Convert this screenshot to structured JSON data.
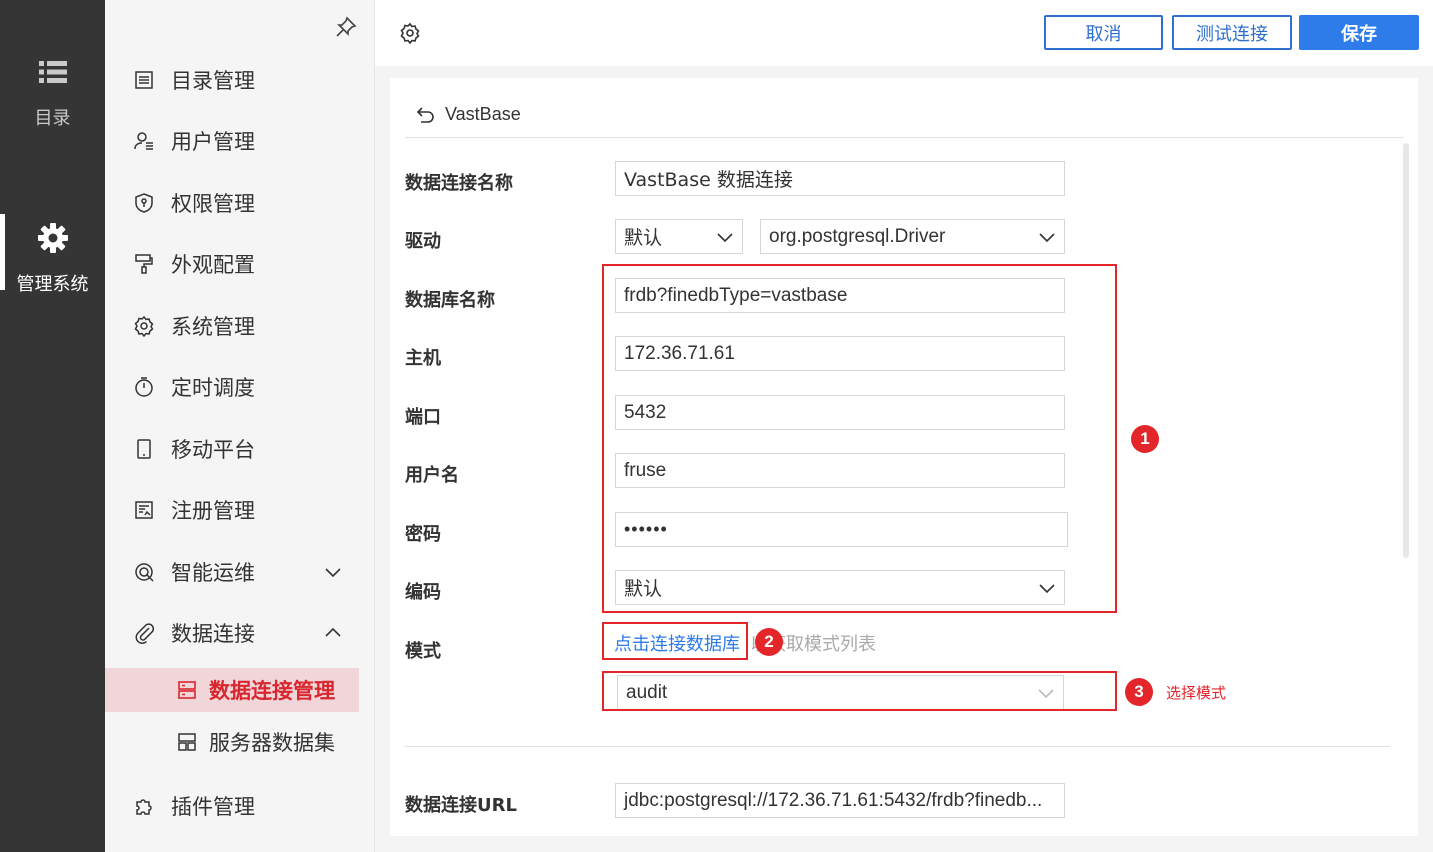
{
  "rail": {
    "catalog_label": "目录",
    "admin_label": "管理系统"
  },
  "menu": {
    "items": [
      {
        "label": "目录管理"
      },
      {
        "label": "用户管理"
      },
      {
        "label": "权限管理"
      },
      {
        "label": "外观配置"
      },
      {
        "label": "系统管理"
      },
      {
        "label": "定时调度"
      },
      {
        "label": "移动平台"
      },
      {
        "label": "注册管理"
      },
      {
        "label": "智能运维"
      },
      {
        "label": "数据连接"
      },
      {
        "label": "插件管理"
      }
    ],
    "sub_items": [
      {
        "label": "数据连接管理",
        "active": true
      },
      {
        "label": "服务器数据集",
        "active": false
      }
    ]
  },
  "toolbar": {
    "cancel_label": "取消",
    "test_label": "测试连接",
    "save_label": "保存"
  },
  "form": {
    "header_title": "VastBase",
    "fields": {
      "name": {
        "label": "数据连接名称",
        "value": "VastBase 数据连接"
      },
      "driver": {
        "label": "驱动",
        "mode_value": "默认",
        "class_value": "org.postgresql.Driver"
      },
      "database": {
        "label": "数据库名称",
        "value": "frdb?finedbType=vastbase"
      },
      "host": {
        "label": "主机",
        "value": "172.36.71.61"
      },
      "port": {
        "label": "端口",
        "value": "5432"
      },
      "user": {
        "label": "用户名",
        "value": "fruse"
      },
      "password": {
        "label": "密码",
        "value": "••••••"
      },
      "encoding": {
        "label": "编码",
        "value": "默认"
      },
      "schema": {
        "label": "模式",
        "link_text": "点击连接数据库",
        "trail_text": "以获取模式列表",
        "value": "audit"
      },
      "url": {
        "label": "数据连接URL",
        "value": "jdbc:postgresql://172.36.71.61:5432/frdb?finedb..."
      }
    }
  },
  "annotations": {
    "badge1": "1",
    "badge2": "2",
    "badge3": "3",
    "note3": "选择模式",
    "color": "#e3262a"
  },
  "colors": {
    "accent": "#2e7bea",
    "rail_bg": "#353535",
    "active_menu_bg": "#f0d6d8",
    "active_menu_text": "#d9262e"
  }
}
